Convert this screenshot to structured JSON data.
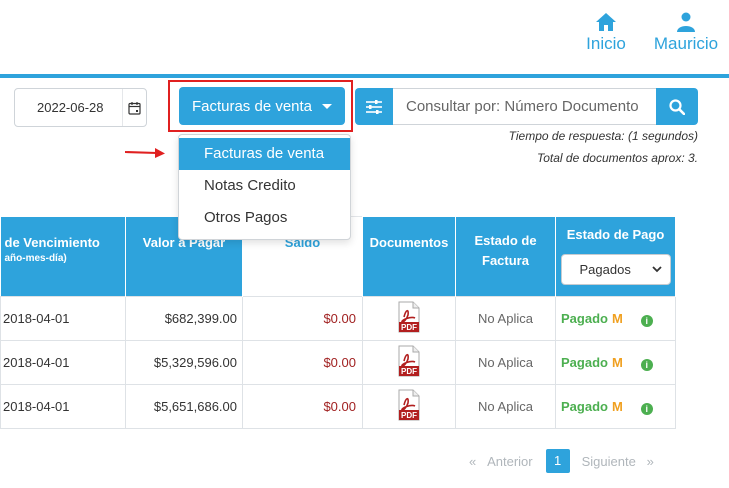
{
  "nav": {
    "home_label": "Inicio",
    "user_label": "Mauricio"
  },
  "toolbar": {
    "date_value": "2022-06-28",
    "doc_type_selected": "Facturas de venta",
    "search_placeholder": "Consultar por: Número Documento",
    "response_time": "Tiempo de respuesta: (1 segundos)",
    "total_docs": "Total de documentos aprox: 3."
  },
  "dropdown": {
    "items": [
      {
        "label": "Facturas de venta",
        "active": true
      },
      {
        "label": "Notas Credito",
        "active": false
      },
      {
        "label": "Otros Pagos",
        "active": false
      }
    ]
  },
  "table": {
    "headers": {
      "vencimiento": "de Vencimiento",
      "vencimiento_sub": "año-mes-día)",
      "valor": "Valor a Pagar",
      "saldo": "Saldo",
      "documentos": "Documentos",
      "estado_factura": "Estado de Factura",
      "estado_pago": "Estado de Pago",
      "estado_pago_select": "Pagados"
    },
    "rows": [
      {
        "fecha": "2018-04-01",
        "valor": "$682,399.00",
        "saldo": "$0.00",
        "doc": "PDF",
        "estado": "No Aplica",
        "pago": "Pagado",
        "pago_m": "M"
      },
      {
        "fecha": "2018-04-01",
        "valor": "$5,329,596.00",
        "saldo": "$0.00",
        "doc": "PDF",
        "estado": "No Aplica",
        "pago": "Pagado",
        "pago_m": "M"
      },
      {
        "fecha": "2018-04-01",
        "valor": "$5,651,686.00",
        "saldo": "$0.00",
        "doc": "PDF",
        "estado": "No Aplica",
        "pago": "Pagado",
        "pago_m": "M"
      }
    ]
  },
  "pagination": {
    "prev": "«",
    "prev_label": "Anterior",
    "current": "1",
    "next_label": "Siguiente",
    "next": "»"
  },
  "colors": {
    "accent": "#2ea3dc",
    "highlight": "#e02020",
    "paid": "#4caf50",
    "m_badge": "#f0a020",
    "saldo": "#a12222"
  }
}
